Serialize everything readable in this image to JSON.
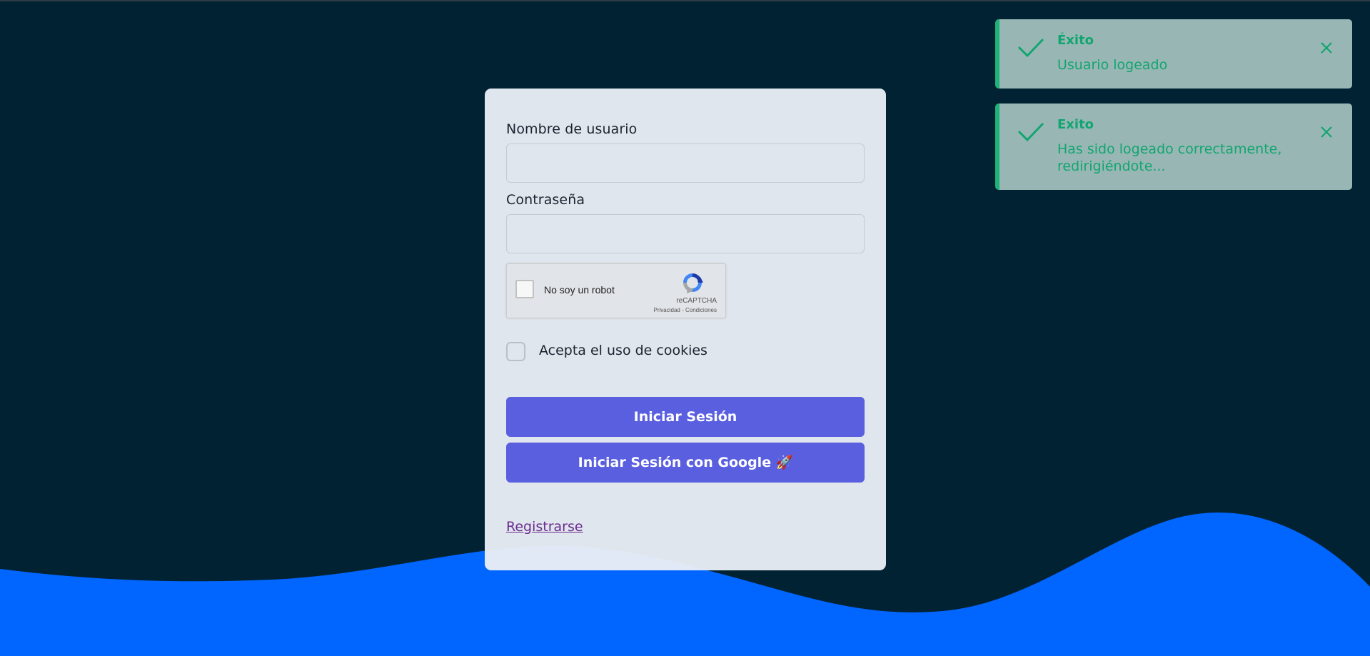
{
  "login_form": {
    "username_label": "Nombre de usuario",
    "username_value": "",
    "password_label": "Contraseña",
    "password_value": "",
    "recaptcha": {
      "checkbox_label": "No soy un robot",
      "brand": "reCAPTCHA",
      "links": "Privacidad - Condiciones"
    },
    "cookies_label": "Acepta el uso de cookies",
    "cookies_checked": false,
    "login_button": "Iniciar Sesión",
    "google_button": "Iniciar Sesión con Google 🚀",
    "register_link": "Registrarse"
  },
  "toasts": [
    {
      "title": "Éxito",
      "message": "Usuario logeado",
      "icon": "check-icon"
    },
    {
      "title": "Exito",
      "message": "Has sido logeado correctamente, redirigiéndote...",
      "icon": "check-icon"
    }
  ],
  "colors": {
    "background": "#012233",
    "wave": "#0066ff",
    "card": "#e9eef5",
    "button": "#5a5fe0",
    "toast_bg": "#98b7b4",
    "toast_accent": "#1fb37a",
    "link": "#6a2c8f"
  }
}
